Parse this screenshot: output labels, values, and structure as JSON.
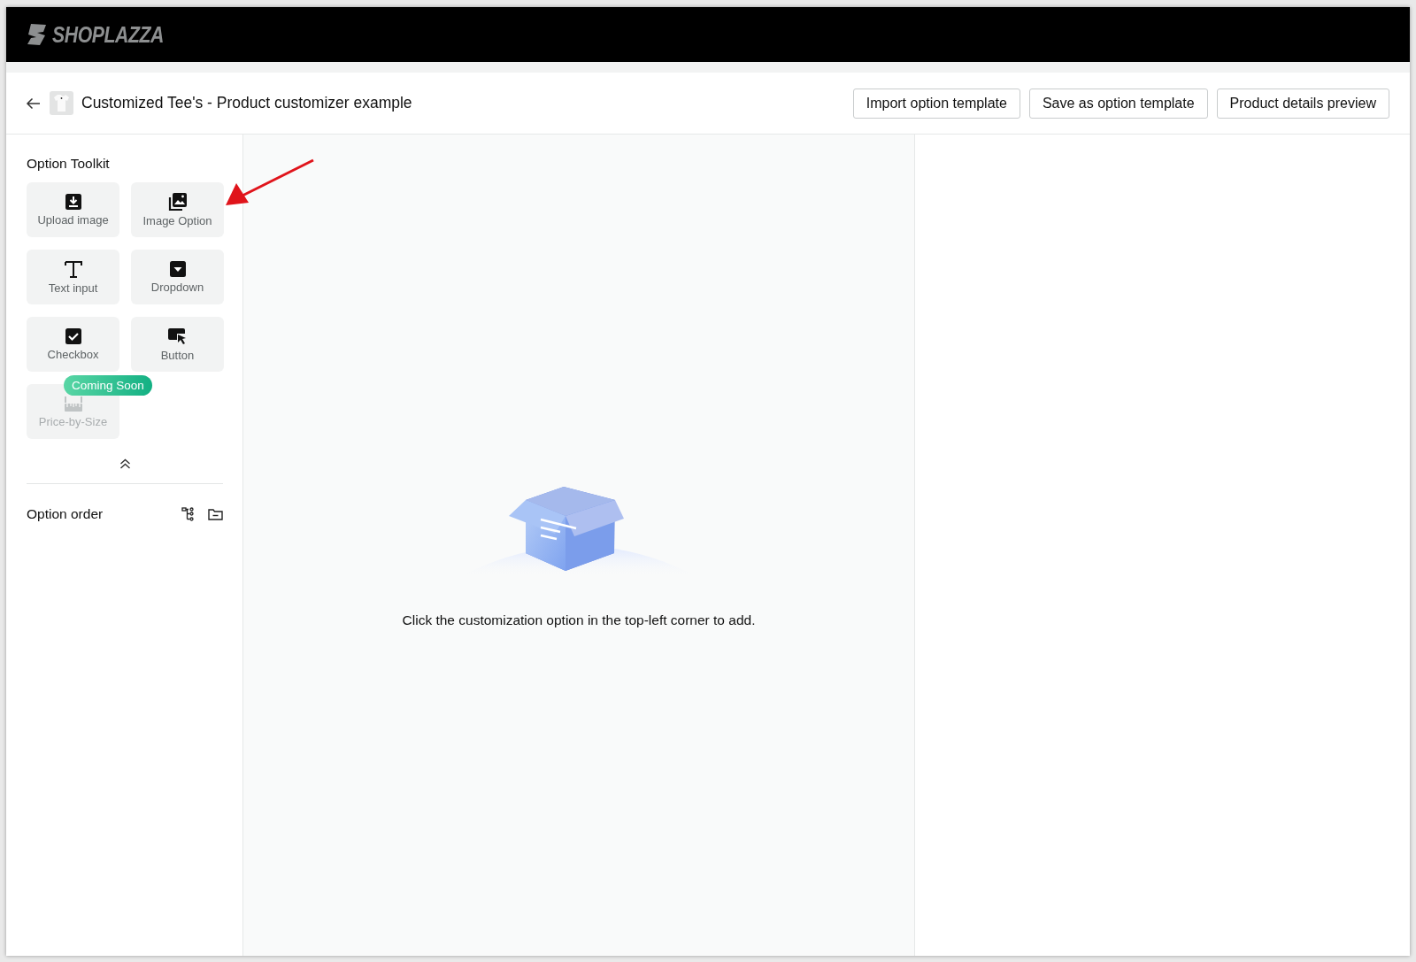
{
  "brand": {
    "name": "SHOPLAZZA"
  },
  "header": {
    "title": "Customized Tee's - Product customizer example",
    "buttons": [
      "Import option template",
      "Save as option template",
      "Product details preview"
    ]
  },
  "toolkit": {
    "title": "Option Toolkit",
    "tools": [
      {
        "label": "Upload image",
        "kind": "upload",
        "disabled": false
      },
      {
        "label": "Image Option",
        "kind": "images",
        "disabled": false
      },
      {
        "label": "Text input",
        "kind": "text",
        "disabled": false
      },
      {
        "label": "Dropdown",
        "kind": "dropdown",
        "disabled": false
      },
      {
        "label": "Checkbox",
        "kind": "checkbox",
        "disabled": false
      },
      {
        "label": "Button",
        "kind": "button",
        "disabled": false
      },
      {
        "label": "Price-by-Size",
        "kind": "ruler",
        "disabled": true,
        "badge": "Coming Soon"
      }
    ]
  },
  "option_order": {
    "title": "Option order"
  },
  "empty_state": {
    "message": "Click the customization option in the top-left corner to add."
  }
}
